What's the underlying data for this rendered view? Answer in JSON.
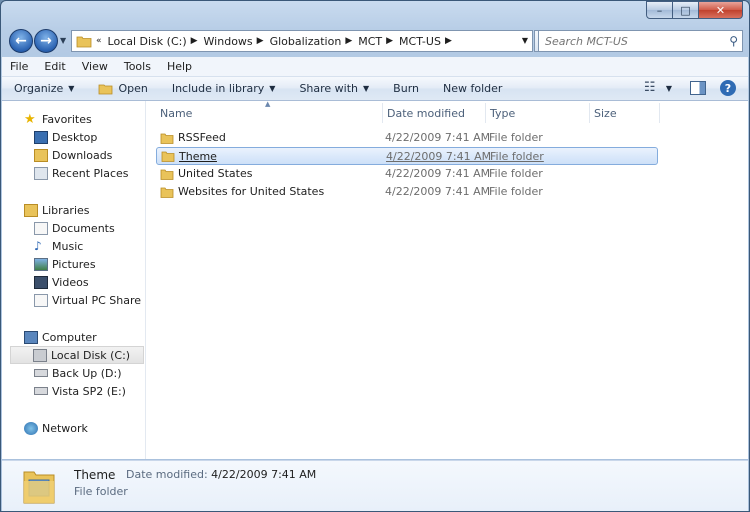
{
  "window": {
    "minimize": "–",
    "maximize": "□",
    "close": "✕"
  },
  "nav": {
    "back_icon": "back-arrow-icon",
    "forward_icon": "forward-arrow-icon"
  },
  "address": {
    "prefix": "«",
    "crumbs": [
      "Local Disk (C:)",
      "Windows",
      "Globalization",
      "MCT",
      "MCT-US"
    ]
  },
  "search": {
    "placeholder": "Search MCT-US"
  },
  "menu": [
    "File",
    "Edit",
    "View",
    "Tools",
    "Help"
  ],
  "commands": {
    "organize": "Organize",
    "open": "Open",
    "include": "Include in library",
    "share": "Share with",
    "burn": "Burn",
    "new_folder": "New folder"
  },
  "sidebar": {
    "favorites": {
      "label": "Favorites",
      "items": [
        "Desktop",
        "Downloads",
        "Recent Places"
      ]
    },
    "libraries": {
      "label": "Libraries",
      "items": [
        "Documents",
        "Music",
        "Pictures",
        "Videos",
        "Virtual PC Share"
      ]
    },
    "computer": {
      "label": "Computer",
      "items": [
        "Local Disk (C:)",
        "Back Up (D:)",
        "Vista SP2 (E:)"
      ]
    },
    "network": {
      "label": "Network"
    }
  },
  "columns": {
    "name": "Name",
    "date": "Date modified",
    "type": "Type",
    "size": "Size"
  },
  "files": [
    {
      "name": "RSSFeed",
      "date": "4/22/2009 7:41 AM",
      "type": "File folder"
    },
    {
      "name": "Theme",
      "date": "4/22/2009 7:41 AM",
      "type": "File folder"
    },
    {
      "name": "United States",
      "date": "4/22/2009 7:41 AM",
      "type": "File folder"
    },
    {
      "name": "Websites for United States",
      "date": "4/22/2009 7:41 AM",
      "type": "File folder"
    }
  ],
  "details": {
    "name": "Theme",
    "type": "File folder",
    "modified_label": "Date modified:",
    "modified_value": "4/22/2009 7:41 AM"
  },
  "colors": {
    "selection": "#cde0f8",
    "selection_border": "#84acdd",
    "folder": "#e9c35a"
  }
}
